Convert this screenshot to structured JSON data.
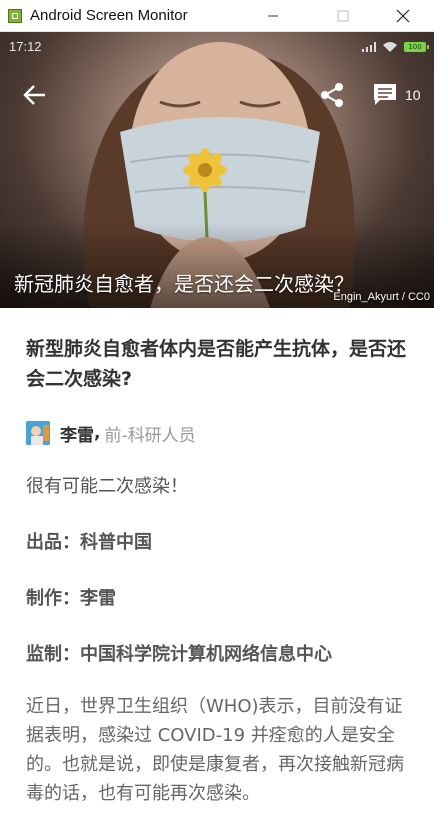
{
  "window": {
    "title": "Android Screen Monitor",
    "minimize_glyph": "—",
    "maximize_glyph": "☐",
    "close_glyph": "✕"
  },
  "status_bar": {
    "time": "17:12",
    "battery": "100"
  },
  "hero": {
    "title": "新冠肺炎自愈者，是否还会二次感染？",
    "credit": "Engin_Akyurt / CC0",
    "comment_count": "10"
  },
  "article": {
    "question": "新型肺炎自愈者体内是否能产生抗体，是否还会二次感染?",
    "author": {
      "name": "李雷",
      "separator": ",",
      "title": "前-科研人员"
    },
    "lead": "很有可能二次感染！",
    "meta": [
      {
        "label": "出品：",
        "value": "科普中国"
      },
      {
        "label": "制作：",
        "value": "李雷"
      },
      {
        "label": "监制：",
        "value": "中国科学院计算机网络信息中心"
      }
    ],
    "body": "近日，世界卫生组织（WHO)表示，目前没有证据表明，感染过 COVID-19 并痊愈的人是安全的。也就是说，即使是康复者，再次接触新冠病毒的话，也有可能再次感染。"
  },
  "colors": {
    "accent_battery": "#7ad14a",
    "text_primary": "#333333",
    "text_secondary": "#999999"
  }
}
